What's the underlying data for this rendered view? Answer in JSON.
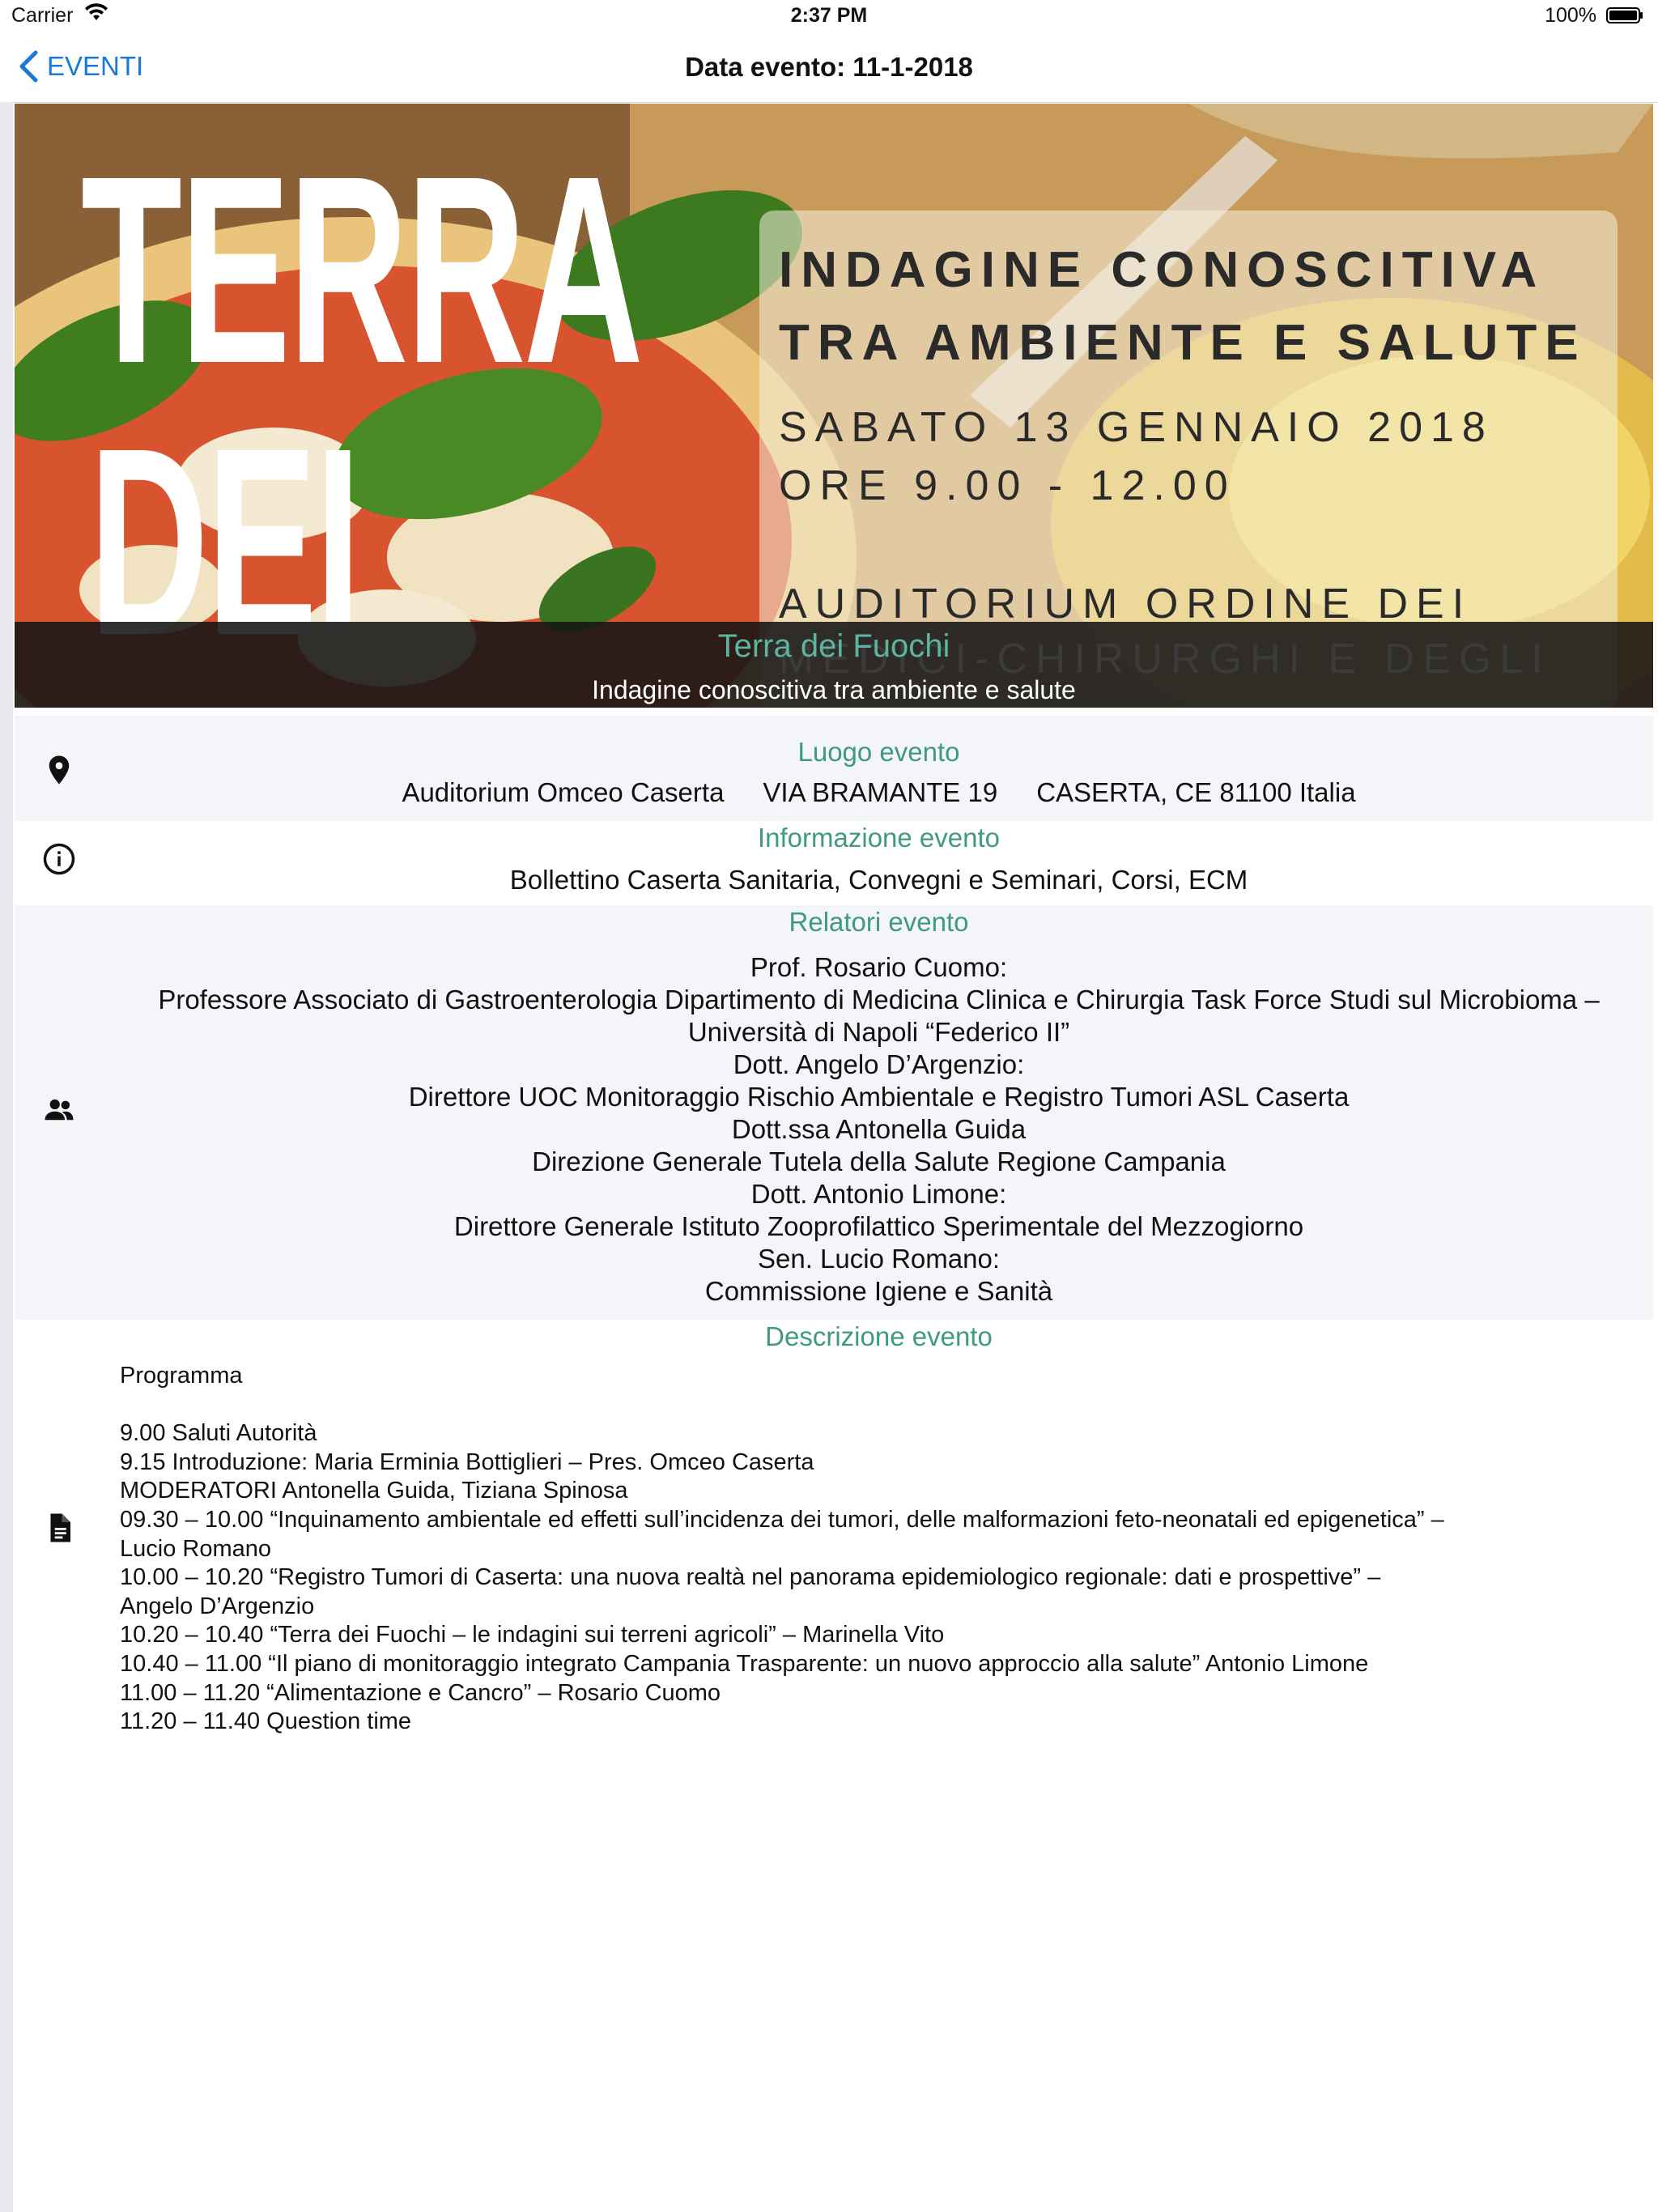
{
  "status_bar": {
    "carrier": "Carrier",
    "time": "2:37 PM",
    "battery": "100%"
  },
  "nav": {
    "back_label": "EVENTI",
    "title": "Data evento: 11-1-2018"
  },
  "hero": {
    "poster_word_1": "TERRA",
    "poster_word_2": "DEI",
    "poster_line_1": "INDAGINE CONOSCITIVA",
    "poster_line_2": "TRA AMBIENTE E SALUTE",
    "poster_line_3": "SABATO 13 GENNAIO 2018",
    "poster_line_4": "ORE 9.00 - 12.00",
    "poster_line_5": "AUDITORIUM ORDINE DEI",
    "poster_line_6": "MEDICI-CHIRURGHI E DEGLI",
    "overlay_title": "Terra dei Fuochi",
    "overlay_subtitle": "Indagine conoscitiva tra ambiente e salute"
  },
  "luogo": {
    "heading": "Luogo evento",
    "venue": "Auditorium Omceo Caserta",
    "street": "VIA BRAMANTE 19",
    "city": "CASERTA, CE 81100 Italia",
    "icon": "location-pin-icon"
  },
  "informazione": {
    "heading": "Informazione evento",
    "text": "Bollettino Caserta Sanitaria, Convegni e Seminari, Corsi, ECM",
    "icon": "info-icon"
  },
  "relatori": {
    "heading": "Relatori evento",
    "icon": "people-icon",
    "lines": [
      "Prof. Rosario Cuomo:",
      "Professore Associato di Gastroenterologia Dipartimento di Medicina Clinica e Chirurgia Task Force Studi sul Microbioma –",
      "Università di Napoli “Federico II”",
      "Dott. Angelo D’Argenzio:",
      "Direttore UOC Monitoraggio Rischio Ambientale e Registro Tumori ASL Caserta",
      "Dott.ssa Antonella Guida",
      "Direzione Generale Tutela della Salute Regione Campania",
      "Dott. Antonio Limone:",
      "Direttore Generale Istituto Zooprofilattico Sperimentale del Mezzogiorno",
      "Sen. Lucio Romano:",
      "Commissione Igiene e Sanità"
    ]
  },
  "descrizione": {
    "heading": "Descrizione evento",
    "icon": "document-icon",
    "lines": [
      "Programma",
      "",
      "9.00 Saluti Autorità",
      "9.15 Introduzione: Maria Erminia Bottiglieri – Pres. Omceo Caserta",
      "MODERATORI Antonella Guida, Tiziana Spinosa",
      "09.30 – 10.00 “Inquinamento ambientale ed effetti sull’incidenza dei tumori, delle malformazioni feto-neonatali ed epigenetica” –",
      "Lucio Romano",
      "10.00 – 10.20 “Registro Tumori di Caserta: una nuova realtà nel panorama epidemiologico regionale: dati e prospettive” –",
      "Angelo D’Argenzio",
      "10.20 – 10.40 “Terra dei Fuochi – le indagini sui terreni agricoli” – Marinella Vito",
      "10.40 – 11.00 “Il piano di monitoraggio integrato Campania Trasparente: un nuovo approccio alla salute” Antonio Limone",
      "11.00 – 11.20 “Alimentazione e Cancro” – Rosario Cuomo",
      "11.20 – 11.40 Question time"
    ]
  }
}
